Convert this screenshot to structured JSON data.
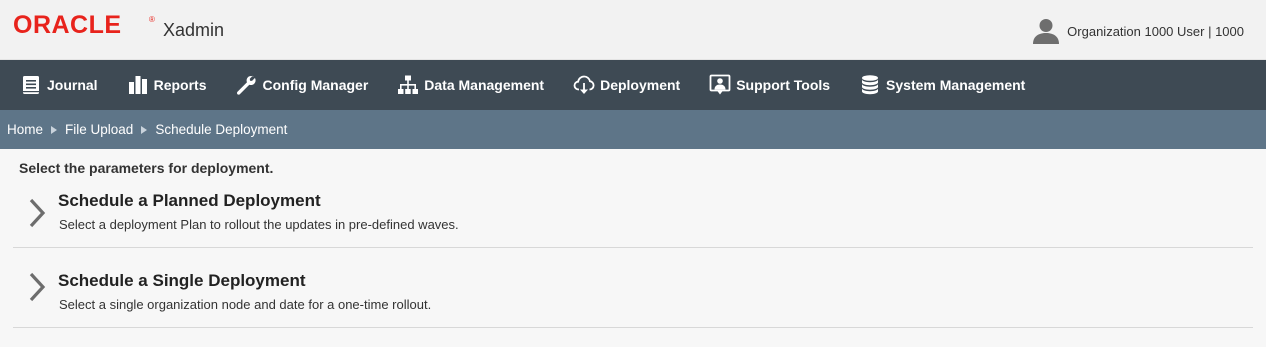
{
  "header": {
    "logo": "ORACLE",
    "logo_mark": "®",
    "app_name": "Xadmin",
    "user_label": "Organization 1000 User | 1000",
    "user_icon": "person-icon"
  },
  "nav": {
    "items": [
      {
        "label": "Journal",
        "icon": "journal-icon"
      },
      {
        "label": "Reports",
        "icon": "bar-chart-icon"
      },
      {
        "label": "Config Manager",
        "icon": "wrench-icon"
      },
      {
        "label": "Data Management",
        "icon": "hierarchy-icon"
      },
      {
        "label": "Deployment",
        "icon": "cloud-download-icon"
      },
      {
        "label": "Support Tools",
        "icon": "support-person-icon"
      },
      {
        "label": "System Management",
        "icon": "database-icon"
      }
    ]
  },
  "breadcrumb": {
    "items": [
      "Home",
      "File Upload",
      "Schedule Deployment"
    ]
  },
  "main": {
    "intro": "Select the parameters for deployment.",
    "options": [
      {
        "title": "Schedule a Planned Deployment",
        "description": "Select a deployment Plan to rollout the updates in pre-defined waves."
      },
      {
        "title": "Schedule a Single Deployment",
        "description": "Select a single organization node and date for a one-time rollout."
      }
    ]
  },
  "colors": {
    "brand_red": "#e8231c",
    "nav_bg": "#3e4a54",
    "breadcrumb_bg": "#5e7588",
    "page_bg": "#f7f7f7"
  }
}
